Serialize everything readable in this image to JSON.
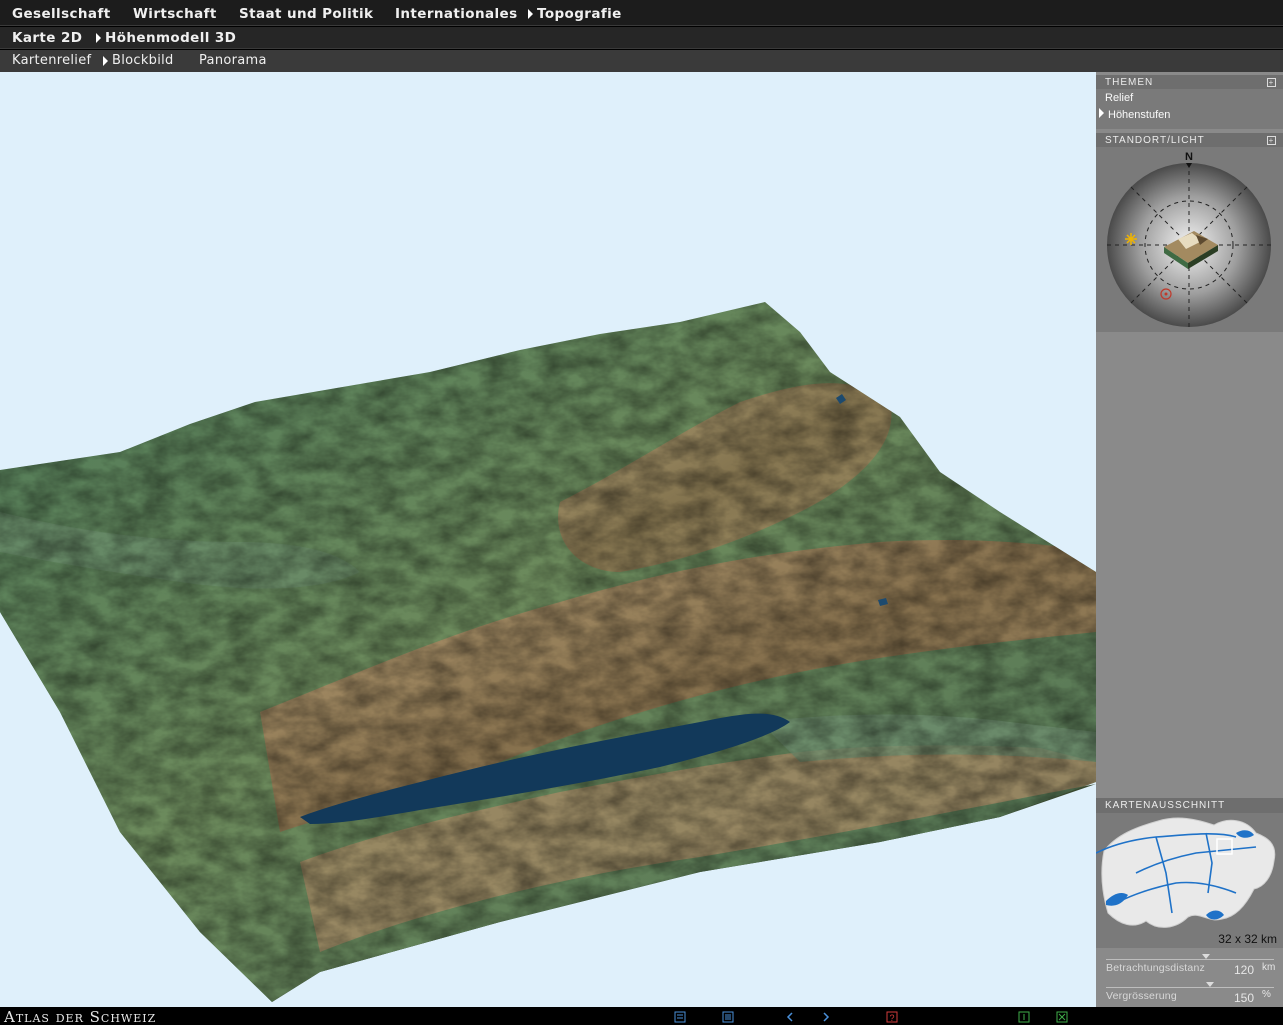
{
  "nav": {
    "level1": [
      "Gesellschaft",
      "Wirtschaft",
      "Staat und Politik",
      "Internationales",
      "Topografie"
    ],
    "level2": [
      "Karte 2D",
      "Höhenmodell 3D"
    ],
    "level3": [
      "Kartenrelief",
      "Blockbild",
      "Panorama"
    ]
  },
  "panel": {
    "themen_title": "THEMEN",
    "themen_items": [
      "Relief",
      "Höhenstufen"
    ],
    "standort_title": "STANDORT/LICHT",
    "compass_north": "N",
    "kartenausschnitt_title": "KARTENAUSSCHNITT",
    "scale": "32 x 32 km",
    "distance_label": "Betrachtungsdistanz",
    "distance_value": "120",
    "distance_unit": "km",
    "zoom_label": "Vergrösserung",
    "zoom_value": "150",
    "zoom_unit": "%"
  },
  "footer": {
    "brand": "Atlas der Schweiz",
    "icons": [
      "legend-icon",
      "text-icon",
      "back-arrow-icon",
      "forward-arrow-icon",
      "help-icon",
      "window-icon",
      "close-icon"
    ]
  },
  "colors": {
    "sky": "#dff0fb",
    "lake": "#12395a",
    "lowland": "#5a7f5a",
    "rock": "#a88a66"
  }
}
